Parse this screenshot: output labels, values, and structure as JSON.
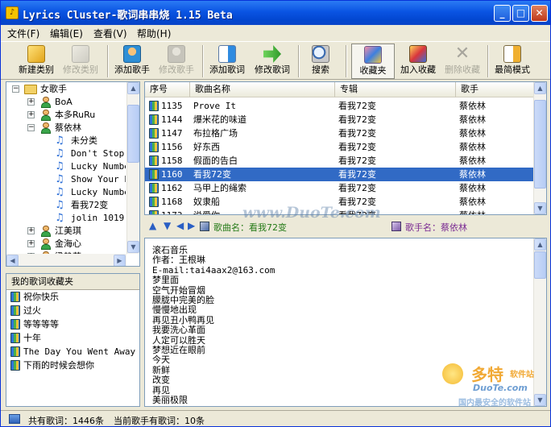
{
  "window": {
    "title": "Lyrics Cluster-歌词串串烧 1.15 Beta",
    "controls": [
      "_",
      "□",
      "✕"
    ]
  },
  "menu": [
    "文件(F)",
    "编辑(E)",
    "查看(V)",
    "帮助(H)"
  ],
  "toolbar": [
    {
      "label": "新建类别",
      "enabled": true
    },
    {
      "label": "修改类别",
      "enabled": false
    },
    {
      "label": "添加歌手",
      "enabled": true
    },
    {
      "label": "修改歌手",
      "enabled": false
    },
    {
      "label": "添加歌词",
      "enabled": true
    },
    {
      "label": "修改歌词",
      "enabled": true
    },
    {
      "label": "搜索",
      "enabled": true
    },
    {
      "label": "收藏夹",
      "enabled": true,
      "selected": true
    },
    {
      "label": "加入收藏",
      "enabled": true
    },
    {
      "label": "删除收藏",
      "enabled": false
    },
    {
      "label": "最简模式",
      "enabled": true
    }
  ],
  "tree": {
    "root": "女歌手",
    "items": [
      {
        "label": "BoA",
        "level": 1,
        "type": "singer",
        "expander": "+"
      },
      {
        "label": "本多RuRu",
        "level": 1,
        "type": "singer",
        "expander": "+"
      },
      {
        "label": "蔡依林",
        "level": 1,
        "type": "singer",
        "expander": "-"
      },
      {
        "label": "未分类",
        "level": 2,
        "type": "album"
      },
      {
        "label": "Don't Stop",
        "level": 2,
        "type": "album"
      },
      {
        "label": "Lucky Number",
        "level": 2,
        "type": "album"
      },
      {
        "label": "Show Your L",
        "level": 2,
        "type": "album"
      },
      {
        "label": "Lucky Numbe",
        "level": 2,
        "type": "album"
      },
      {
        "label": "看我72变",
        "level": 2,
        "type": "album"
      },
      {
        "label": "jolin 1019",
        "level": 2,
        "type": "album"
      },
      {
        "label": "江美琪",
        "level": 1,
        "type": "singer",
        "expander": "+"
      },
      {
        "label": "金海心",
        "level": 1,
        "type": "singer",
        "expander": "+"
      },
      {
        "label": "梁静茹",
        "level": 1,
        "type": "singer",
        "expander": "+"
      }
    ]
  },
  "favorites": {
    "header": "我的歌词收藏夹",
    "items": [
      "祝你快乐",
      "过火",
      "等等等等",
      "十年",
      "The Day You Went Away",
      "下雨的时候会想你"
    ]
  },
  "song_list": {
    "columns": [
      "序号",
      "歌曲名称",
      "专辑",
      "歌手"
    ],
    "rows": [
      {
        "id": "1135",
        "title": "Prove It",
        "album": "看我72变",
        "singer": "蔡依林"
      },
      {
        "id": "1144",
        "title": "爆米花的味道",
        "album": "看我72变",
        "singer": "蔡依林"
      },
      {
        "id": "1147",
        "title": "布拉格广场",
        "album": "看我72变",
        "singer": "蔡依林"
      },
      {
        "id": "1156",
        "title": "好东西",
        "album": "看我72变",
        "singer": "蔡依林"
      },
      {
        "id": "1158",
        "title": "假面的告白",
        "album": "看我72变",
        "singer": "蔡依林"
      },
      {
        "id": "1160",
        "title": "看我72变",
        "album": "看我72变",
        "singer": "蔡依林",
        "selected": true
      },
      {
        "id": "1162",
        "title": "马甲上的绳索",
        "album": "看我72变",
        "singer": "蔡依林"
      },
      {
        "id": "1168",
        "title": "奴隶船",
        "album": "看我72变",
        "singer": "蔡依林"
      },
      {
        "id": "1173",
        "title": "说爱你",
        "album": "看我72变",
        "singer": "蔡依林"
      }
    ]
  },
  "song_info": {
    "song_label": "歌曲名：看我72变",
    "singer_label": "歌手名：蔡依林"
  },
  "lyrics": [
    "滚石音乐",
    "作者：王根琳",
    "E-mail:tai4aax2@163.com",
    "梦里面",
    "空气开始冒烟",
    "朦胧中完美的脸",
    "慢慢地出现",
    "再见丑小鸭再见",
    "我要洗心革面",
    "人定可以胜天",
    "梦想近在眼前",
    "今天",
    "新鲜",
    "改变",
    "再见",
    "美丽极限"
  ],
  "status": {
    "total": "共有歌词：1446条",
    "current": "当前歌手有歌词：10条"
  },
  "watermarks": {
    "center": "www.DuoTe.com",
    "logo_text": "多特",
    "logo_sub": "软件站",
    "logo_url": "DuoTe.com",
    "logo_slogan": "国内最安全的软件站"
  }
}
